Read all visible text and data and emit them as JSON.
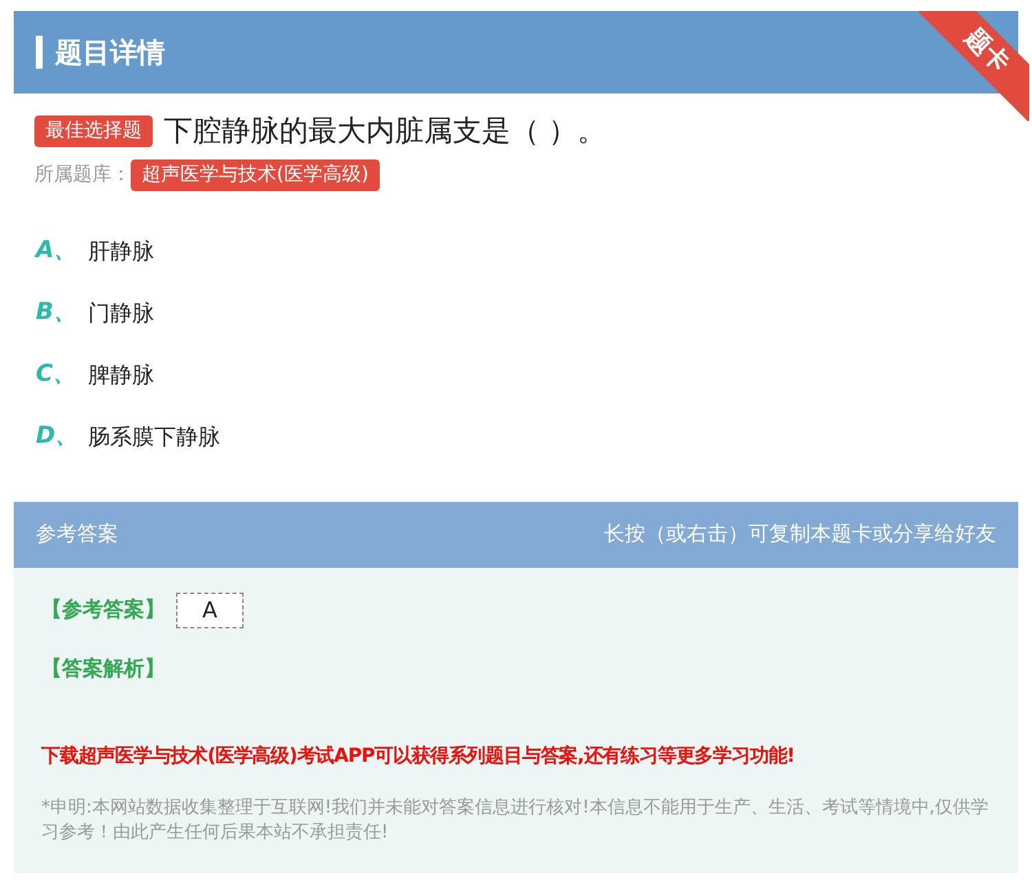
{
  "header": {
    "title": "题目详情",
    "ribbon": "题卡"
  },
  "question": {
    "type_tag": "最佳选择题",
    "text": "下腔静脉的最大内脏属支是（ ）。",
    "bank_label": "所属题库：",
    "bank": "超声医学与技术(医学高级)"
  },
  "options": [
    {
      "letter": "A、",
      "text": "肝静脉"
    },
    {
      "letter": "B、",
      "text": "门静脉"
    },
    {
      "letter": "C、",
      "text": "脾静脉"
    },
    {
      "letter": "D、",
      "text": "肠系膜下静脉"
    }
  ],
  "answer_section": {
    "title": "参考答案",
    "hint": "长按（或右击）可复制本题卡或分享给好友",
    "answer_label": "【参考答案】",
    "answer": "A",
    "analysis_label": "【答案解析】",
    "promo": "下载超声医学与技术(医学高级)考试APP可以获得系列题目与答案,还有练习等更多学习功能!",
    "disclaimer": "*申明:本网站数据收集整理于互联网!我们并未能对答案信息进行核对!本信息不能用于生产、生活、考试等情境中,仅供学习参考！由此产生任何后果本站不承担责任!"
  }
}
